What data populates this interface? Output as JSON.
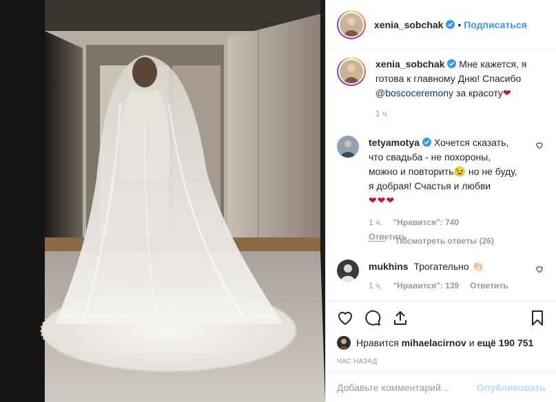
{
  "header": {
    "username": "xenia_sobchak",
    "separator": "•",
    "follow_label": "Подписаться"
  },
  "caption": {
    "username": "xenia_sobchak",
    "text_before": "Мне кажется, я готова к главному Дню! Спасибо",
    "mention": "@boscoceremony",
    "text_after": "за красоту",
    "emoji": "❤",
    "time": "1 ч."
  },
  "comments": [
    {
      "username": "tetyamotya",
      "text": "Хочется сказать, что свадьба - не похороны, можно и повторить",
      "emoji1": "😉",
      "text2": "но не буду, я добрая! Счастья и любви",
      "hearts": "❤❤❤",
      "time": "1 ч.",
      "likes": "\"Нравится\": 740",
      "reply_label": "Ответить",
      "view_replies": "Посмотреть ответы (26)"
    },
    {
      "username": "mukhins",
      "text": "Трогательно",
      "emoji1": "👏🏻",
      "time": "1 ч.",
      "likes": "\"Нравится\": 139",
      "reply_label": "Ответить"
    }
  ],
  "likes": {
    "prefix": "Нравится",
    "user": "mihaelacirnov",
    "connector": "и",
    "others": "ещё 190 751"
  },
  "timestamp": "ЧАС НАЗАД",
  "add_comment": {
    "placeholder": "Добавьте комментарий...",
    "publish_label": "Опубликовать"
  },
  "colors": {
    "accent": "#3897f0",
    "publish_disabled": "#b2dffc",
    "heart": "#c0182a"
  }
}
